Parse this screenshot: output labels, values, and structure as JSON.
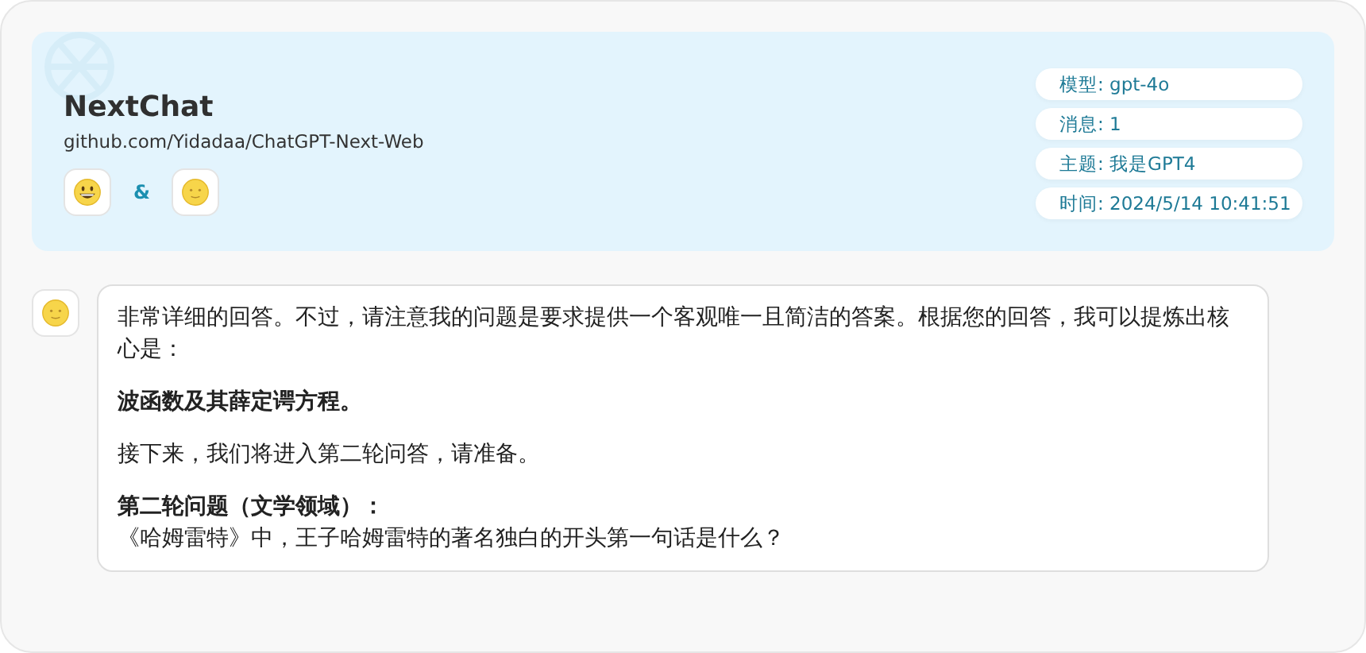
{
  "header": {
    "title": "NextChat",
    "subtitle": "github.com/Yidadaa/ChatGPT-Next-Web",
    "separator": "&"
  },
  "info": [
    {
      "text": "模型: gpt-4o"
    },
    {
      "text": "消息: 1"
    },
    {
      "text": "主题: 我是GPT4"
    },
    {
      "text": "时间: 2024/5/14 10:41:51"
    }
  ],
  "messages": [
    {
      "paragraphs": [
        {
          "lines": [
            {
              "text": "非常详细的回答。不过，请注意我的问题是要求提供一个客观唯一且简洁的答案。根据您的回答，我可以提炼出核心是：",
              "bold": false
            }
          ]
        },
        {
          "lines": [
            {
              "text": "波函数及其薛定谔方程。",
              "bold": true
            }
          ]
        },
        {
          "lines": [
            {
              "text": "接下来，我们将进入第二轮问答，请准备。",
              "bold": false
            }
          ]
        },
        {
          "lines": [
            {
              "text": "第二轮问题（文学领域）：",
              "bold": true
            },
            {
              "text": "《哈姆雷特》中，王子哈姆雷特的著名独白的开头第一句话是什么？",
              "bold": false
            }
          ]
        }
      ]
    }
  ]
}
